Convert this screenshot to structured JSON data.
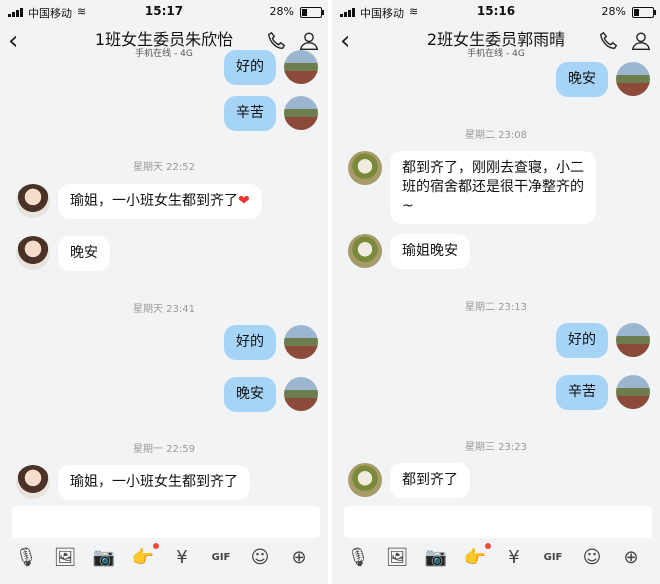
{
  "status": {
    "carrier": "中国移动",
    "battery": "28%",
    "battery_level": 0.28
  },
  "left": {
    "time": "15:17",
    "title": "1班女生委员朱欣怡",
    "subtitle": "手机在线 - 4G",
    "messages": [
      {
        "kind": "out",
        "text": "好的",
        "avatar": "self"
      },
      {
        "kind": "out",
        "text": "辛苦",
        "avatar": "self"
      },
      {
        "kind": "ts",
        "text": "星期天 22:52"
      },
      {
        "kind": "in",
        "text": "瑜姐，一小班女生都到齐了",
        "heart": "❤",
        "avatar": "girl"
      },
      {
        "kind": "in",
        "text": "晚安",
        "avatar": "girl"
      },
      {
        "kind": "ts",
        "text": "星期天 23:41"
      },
      {
        "kind": "out",
        "text": "好的",
        "avatar": "self"
      },
      {
        "kind": "out",
        "text": "晚安",
        "avatar": "self"
      },
      {
        "kind": "ts",
        "text": "星期一 22:59"
      },
      {
        "kind": "in",
        "text": "瑜姐，一小班女生都到齐了",
        "avatar": "girl"
      }
    ]
  },
  "right": {
    "time": "15:16",
    "title": "2班女生委员郭雨晴",
    "subtitle": "手机在线 - 4G",
    "messages": [
      {
        "kind": "out",
        "text": "晚安",
        "avatar": "self"
      },
      {
        "kind": "ts",
        "text": "星期二 23:08"
      },
      {
        "kind": "in",
        "text": "都到齐了，刚刚去查寝，小二\n班的宿舍都还是很干净整齐的\n~",
        "avatar": "bird"
      },
      {
        "kind": "in",
        "text": "瑜姐晚安",
        "avatar": "bird"
      },
      {
        "kind": "ts",
        "text": "星期二 23:13"
      },
      {
        "kind": "out",
        "text": "好的",
        "avatar": "self"
      },
      {
        "kind": "out",
        "text": "辛苦",
        "avatar": "self"
      },
      {
        "kind": "ts",
        "text": "星期三 23:23"
      },
      {
        "kind": "in",
        "text": "都到齐了",
        "avatar": "bird"
      }
    ]
  },
  "toolbar": {
    "icons": [
      "microphone-icon",
      "image-icon",
      "camera-icon",
      "shake-icon",
      "red-packet-icon",
      "gif-icon",
      "emoji-icon",
      "plus-icon"
    ],
    "glyphs": [
      "🎙",
      "🖼",
      "📷",
      "👉",
      "¥",
      "GIF",
      "☺",
      "⊕"
    ],
    "badge_color": "#f04b3a"
  },
  "colors": {
    "bubble_out": "#a6d4f7",
    "bubble_in": "#ffffff",
    "background": "#f2f3f5"
  }
}
